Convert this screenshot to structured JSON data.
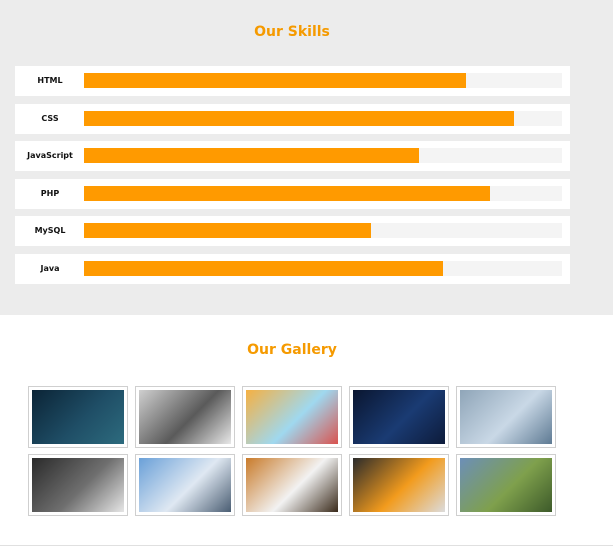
{
  "skills": {
    "title": "Our Skills",
    "items": [
      {
        "label": "HTML",
        "percent": 80
      },
      {
        "label": "CSS",
        "percent": 90
      },
      {
        "label": "JavaScript",
        "percent": 70
      },
      {
        "label": "PHP",
        "percent": 85
      },
      {
        "label": "MySQL",
        "percent": 60
      },
      {
        "label": "Java",
        "percent": 75
      }
    ]
  },
  "gallery": {
    "title": "Our Gallery",
    "images": [
      {
        "name": "laptop-photo",
        "colors": [
          "#0b2436",
          "#1f4e66",
          "#2d6b7e"
        ]
      },
      {
        "name": "brochure-spread-photo",
        "colors": [
          "#cfcfcf",
          "#5a5a5a",
          "#e8e8e8"
        ]
      },
      {
        "name": "colored-pencils-photo",
        "colors": [
          "#f5b042",
          "#9fd8ef",
          "#d9534f"
        ]
      },
      {
        "name": "server-room-person-photo",
        "colors": [
          "#0a1630",
          "#1a3b73",
          "#0d1b3a"
        ]
      },
      {
        "name": "cloud-network-photo",
        "colors": [
          "#8fa5b8",
          "#c9d8e6",
          "#5e7a93"
        ]
      },
      {
        "name": "server-rack-photo",
        "colors": [
          "#2a2a2a",
          "#6f6f6f",
          "#e6e6e6"
        ]
      },
      {
        "name": "snowy-mountains-photo",
        "colors": [
          "#6aa0d8",
          "#dfe8f2",
          "#4a5d72"
        ]
      },
      {
        "name": "open-book-photo",
        "colors": [
          "#c97b2a",
          "#f2f2f2",
          "#3a2a1a"
        ]
      },
      {
        "name": "agency-brochure-photo",
        "colors": [
          "#2b2b2b",
          "#f29b1d",
          "#dcdcdc"
        ]
      },
      {
        "name": "green-valley-mountains-photo",
        "colors": [
          "#6c8fb8",
          "#7fa04c",
          "#3d5a2a"
        ]
      }
    ]
  }
}
